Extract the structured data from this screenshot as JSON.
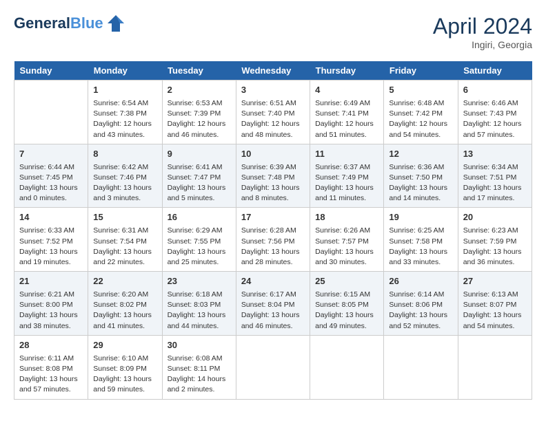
{
  "header": {
    "logo_line1": "General",
    "logo_line2": "Blue",
    "month_title": "April 2024",
    "location": "Ingiri, Georgia"
  },
  "days_of_week": [
    "Sunday",
    "Monday",
    "Tuesday",
    "Wednesday",
    "Thursday",
    "Friday",
    "Saturday"
  ],
  "weeks": [
    [
      {
        "day": "",
        "info": ""
      },
      {
        "day": "1",
        "info": "Sunrise: 6:54 AM\nSunset: 7:38 PM\nDaylight: 12 hours\nand 43 minutes."
      },
      {
        "day": "2",
        "info": "Sunrise: 6:53 AM\nSunset: 7:39 PM\nDaylight: 12 hours\nand 46 minutes."
      },
      {
        "day": "3",
        "info": "Sunrise: 6:51 AM\nSunset: 7:40 PM\nDaylight: 12 hours\nand 48 minutes."
      },
      {
        "day": "4",
        "info": "Sunrise: 6:49 AM\nSunset: 7:41 PM\nDaylight: 12 hours\nand 51 minutes."
      },
      {
        "day": "5",
        "info": "Sunrise: 6:48 AM\nSunset: 7:42 PM\nDaylight: 12 hours\nand 54 minutes."
      },
      {
        "day": "6",
        "info": "Sunrise: 6:46 AM\nSunset: 7:43 PM\nDaylight: 12 hours\nand 57 minutes."
      }
    ],
    [
      {
        "day": "7",
        "info": "Sunrise: 6:44 AM\nSunset: 7:45 PM\nDaylight: 13 hours\nand 0 minutes."
      },
      {
        "day": "8",
        "info": "Sunrise: 6:42 AM\nSunset: 7:46 PM\nDaylight: 13 hours\nand 3 minutes."
      },
      {
        "day": "9",
        "info": "Sunrise: 6:41 AM\nSunset: 7:47 PM\nDaylight: 13 hours\nand 5 minutes."
      },
      {
        "day": "10",
        "info": "Sunrise: 6:39 AM\nSunset: 7:48 PM\nDaylight: 13 hours\nand 8 minutes."
      },
      {
        "day": "11",
        "info": "Sunrise: 6:37 AM\nSunset: 7:49 PM\nDaylight: 13 hours\nand 11 minutes."
      },
      {
        "day": "12",
        "info": "Sunrise: 6:36 AM\nSunset: 7:50 PM\nDaylight: 13 hours\nand 14 minutes."
      },
      {
        "day": "13",
        "info": "Sunrise: 6:34 AM\nSunset: 7:51 PM\nDaylight: 13 hours\nand 17 minutes."
      }
    ],
    [
      {
        "day": "14",
        "info": "Sunrise: 6:33 AM\nSunset: 7:52 PM\nDaylight: 13 hours\nand 19 minutes."
      },
      {
        "day": "15",
        "info": "Sunrise: 6:31 AM\nSunset: 7:54 PM\nDaylight: 13 hours\nand 22 minutes."
      },
      {
        "day": "16",
        "info": "Sunrise: 6:29 AM\nSunset: 7:55 PM\nDaylight: 13 hours\nand 25 minutes."
      },
      {
        "day": "17",
        "info": "Sunrise: 6:28 AM\nSunset: 7:56 PM\nDaylight: 13 hours\nand 28 minutes."
      },
      {
        "day": "18",
        "info": "Sunrise: 6:26 AM\nSunset: 7:57 PM\nDaylight: 13 hours\nand 30 minutes."
      },
      {
        "day": "19",
        "info": "Sunrise: 6:25 AM\nSunset: 7:58 PM\nDaylight: 13 hours\nand 33 minutes."
      },
      {
        "day": "20",
        "info": "Sunrise: 6:23 AM\nSunset: 7:59 PM\nDaylight: 13 hours\nand 36 minutes."
      }
    ],
    [
      {
        "day": "21",
        "info": "Sunrise: 6:21 AM\nSunset: 8:00 PM\nDaylight: 13 hours\nand 38 minutes."
      },
      {
        "day": "22",
        "info": "Sunrise: 6:20 AM\nSunset: 8:02 PM\nDaylight: 13 hours\nand 41 minutes."
      },
      {
        "day": "23",
        "info": "Sunrise: 6:18 AM\nSunset: 8:03 PM\nDaylight: 13 hours\nand 44 minutes."
      },
      {
        "day": "24",
        "info": "Sunrise: 6:17 AM\nSunset: 8:04 PM\nDaylight: 13 hours\nand 46 minutes."
      },
      {
        "day": "25",
        "info": "Sunrise: 6:15 AM\nSunset: 8:05 PM\nDaylight: 13 hours\nand 49 minutes."
      },
      {
        "day": "26",
        "info": "Sunrise: 6:14 AM\nSunset: 8:06 PM\nDaylight: 13 hours\nand 52 minutes."
      },
      {
        "day": "27",
        "info": "Sunrise: 6:13 AM\nSunset: 8:07 PM\nDaylight: 13 hours\nand 54 minutes."
      }
    ],
    [
      {
        "day": "28",
        "info": "Sunrise: 6:11 AM\nSunset: 8:08 PM\nDaylight: 13 hours\nand 57 minutes."
      },
      {
        "day": "29",
        "info": "Sunrise: 6:10 AM\nSunset: 8:09 PM\nDaylight: 13 hours\nand 59 minutes."
      },
      {
        "day": "30",
        "info": "Sunrise: 6:08 AM\nSunset: 8:11 PM\nDaylight: 14 hours\nand 2 minutes."
      },
      {
        "day": "",
        "info": ""
      },
      {
        "day": "",
        "info": ""
      },
      {
        "day": "",
        "info": ""
      },
      {
        "day": "",
        "info": ""
      }
    ]
  ]
}
